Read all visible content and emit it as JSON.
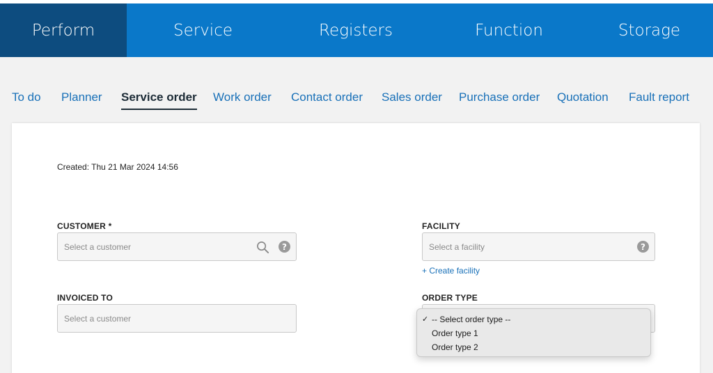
{
  "top_nav": {
    "items": [
      {
        "label": "Perform",
        "active": true
      },
      {
        "label": "Service",
        "active": false
      },
      {
        "label": "Registers",
        "active": false
      },
      {
        "label": "Function",
        "active": false
      },
      {
        "label": "Storage",
        "active": false
      }
    ]
  },
  "sub_nav": {
    "items": [
      {
        "label": "To do"
      },
      {
        "label": "Planner"
      },
      {
        "label": "Service order",
        "active": true
      },
      {
        "label": "Work order"
      },
      {
        "label": "Contact order"
      },
      {
        "label": "Sales order"
      },
      {
        "label": "Purchase order"
      },
      {
        "label": "Quotation"
      },
      {
        "label": "Fault report"
      }
    ]
  },
  "form": {
    "created": "Created: Thu 21 Mar 2024 14:56",
    "customer": {
      "label": "CUSTOMER *",
      "placeholder": "Select a customer"
    },
    "facility": {
      "label": "FACILITY",
      "placeholder": "Select a facility",
      "create_link": "+ Create facility"
    },
    "invoiced_to": {
      "label": "INVOICED TO",
      "placeholder": "Select a customer"
    },
    "order_type": {
      "label": "ORDER TYPE",
      "options": [
        "-- Select order type --",
        "Order type 1",
        "Order type 2"
      ],
      "selected_index": 0,
      "check_mark": "✓"
    },
    "help_glyph": "?"
  },
  "colors": {
    "topbar": "#0a78c9",
    "topbar_active": "#0d4c7f",
    "link": "#1870b8",
    "background": "#f2f2f2"
  },
  "icons": [
    "search-icon",
    "help-icon",
    "check-icon"
  ]
}
